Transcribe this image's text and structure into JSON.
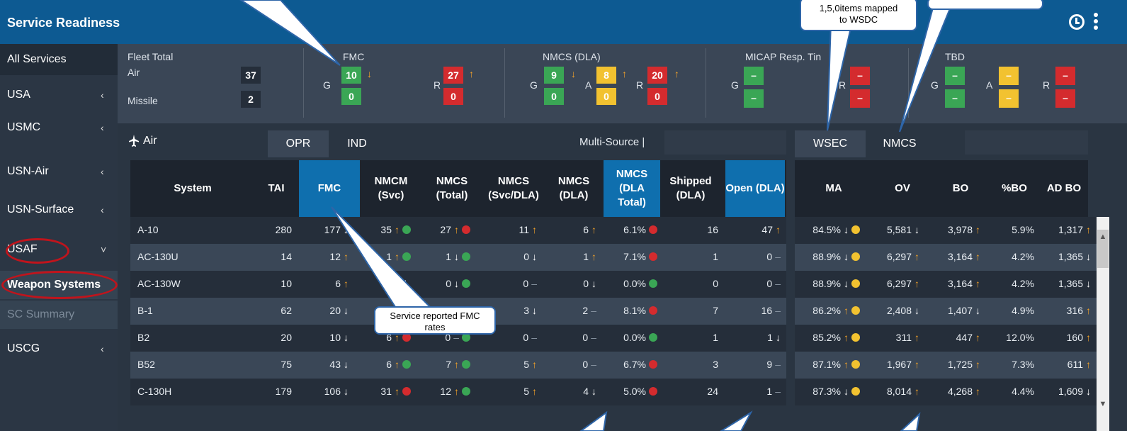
{
  "titlebar": {
    "title": "Service Readiness"
  },
  "sidebar": {
    "items": [
      {
        "label": "All Services"
      },
      {
        "label": "USA",
        "chevron": "‹"
      },
      {
        "label": "USMC",
        "chevron": "‹"
      },
      {
        "label": "USN-Air",
        "chevron": "‹"
      },
      {
        "label": "USN-Surface",
        "chevron": "‹"
      },
      {
        "label": "USAF",
        "chevron": "˅"
      },
      {
        "label": "Weapon Systems"
      },
      {
        "label": "SC Summary"
      },
      {
        "label": "USCG",
        "chevron": "‹"
      }
    ]
  },
  "summary": {
    "fleet": {
      "title": "Fleet Total",
      "air_label": "Air",
      "air_value": "37",
      "missile_label": "Missile",
      "missile_value": "2"
    },
    "fmc": {
      "title": "FMC",
      "g": "G",
      "r": "R",
      "g_top": "10",
      "g_top_arrow": "↓",
      "g_bottom": "0",
      "r_top": "27",
      "r_top_arrow": "↑",
      "r_bottom": "0"
    },
    "nmcs": {
      "title": "NMCS (DLA)",
      "g": "G",
      "a": "A",
      "r": "R",
      "g_top": "9",
      "g_top_arrow": "↓",
      "g_bottom": "0",
      "a_top": "8",
      "a_top_arrow": "↑",
      "a_bottom": "0",
      "r_top": "20",
      "r_top_arrow": "↑",
      "r_bottom": "0"
    },
    "micap": {
      "title": "MICAP Resp. Tin",
      "g": "G",
      "r": "R",
      "dash": "–"
    },
    "tbd": {
      "title": "TBD",
      "g": "G",
      "a": "A",
      "r": "R",
      "dash": "–"
    }
  },
  "toolbar": {
    "air_icon": "airplane-icon",
    "air_label": "Air",
    "tab_opr": "OPR",
    "tab_ind": "IND",
    "multisource": "Multi-Source |",
    "tab_wsec": "WSEC",
    "tab_nmcs": "NMCS"
  },
  "left_table": {
    "headers": [
      "System",
      "TAI",
      "FMC",
      "NMCM (Svc)",
      "NMCS (Total)",
      "NMCS (Svc/DLA)",
      "NMCS (DLA)",
      "NMCS (DLA Total)",
      "Shipped (DLA)",
      "Open (DLA)"
    ],
    "rows": [
      {
        "system": "A-10",
        "tai": "280",
        "fmc": "177",
        "fmc_a": "↓",
        "nmcm": "35",
        "nmcm_a": "↑",
        "nmcm_s": "ok",
        "nmcs_t": "27",
        "nmcs_t_a": "↑",
        "nmcs_t_s": "bad",
        "svcdla": "11",
        "svcdla_a": "↑",
        "dla": "6",
        "dla_a": "↑",
        "dlatot": "6.1%",
        "dlatot_s": "bad",
        "shipped": "16",
        "open": "47",
        "open_a": "↑"
      },
      {
        "system": "AC-130U",
        "tai": "14",
        "fmc": "12",
        "fmc_a": "↑",
        "nmcm": "1",
        "nmcm_a": "↑",
        "nmcm_s": "ok",
        "nmcs_t": "1",
        "nmcs_t_a": "↓",
        "nmcs_t_s": "ok",
        "svcdla": "0",
        "svcdla_a": "↓",
        "dla": "1",
        "dla_a": "↑",
        "dlatot": "7.1%",
        "dlatot_s": "bad",
        "shipped": "1",
        "open": "0",
        "open_a": "–"
      },
      {
        "system": "AC-130W",
        "tai": "10",
        "fmc": "6",
        "fmc_a": "↑",
        "nmcm": "1",
        "nmcm_a": "",
        "nmcm_s": "",
        "nmcs_t": "0",
        "nmcs_t_a": "↓",
        "nmcs_t_s": "ok",
        "svcdla": "0",
        "svcdla_a": "–",
        "dla": "0",
        "dla_a": "↓",
        "dlatot": "0.0%",
        "dlatot_s": "ok",
        "shipped": "0",
        "open": "0",
        "open_a": "–"
      },
      {
        "system": "B-1",
        "tai": "62",
        "fmc": "20",
        "fmc_a": "↓",
        "nmcm": "",
        "nmcm_a": "",
        "nmcm_s": "",
        "nmcs_t": "",
        "nmcs_t_a": "",
        "nmcs_t_s": "",
        "svcdla": "3",
        "svcdla_a": "↓",
        "dla": "2",
        "dla_a": "–",
        "dlatot": "8.1%",
        "dlatot_s": "bad",
        "shipped": "7",
        "open": "16",
        "open_a": "–"
      },
      {
        "system": "B2",
        "tai": "20",
        "fmc": "10",
        "fmc_a": "↓",
        "nmcm": "6",
        "nmcm_a": "↑",
        "nmcm_s": "bad",
        "nmcs_t": "0",
        "nmcs_t_a": "–",
        "nmcs_t_s": "ok",
        "svcdla": "0",
        "svcdla_a": "–",
        "dla": "0",
        "dla_a": "–",
        "dlatot": "0.0%",
        "dlatot_s": "ok",
        "shipped": "1",
        "open": "1",
        "open_a": "↓"
      },
      {
        "system": "B52",
        "tai": "75",
        "fmc": "43",
        "fmc_a": "↓",
        "nmcm": "6",
        "nmcm_a": "↑",
        "nmcm_s": "ok",
        "nmcs_t": "7",
        "nmcs_t_a": "↑",
        "nmcs_t_s": "ok",
        "svcdla": "5",
        "svcdla_a": "↑",
        "dla": "0",
        "dla_a": "–",
        "dlatot": "6.7%",
        "dlatot_s": "bad",
        "shipped": "3",
        "open": "9",
        "open_a": "–"
      },
      {
        "system": "C-130H",
        "tai": "179",
        "fmc": "106",
        "fmc_a": "↓",
        "nmcm": "31",
        "nmcm_a": "↑",
        "nmcm_s": "bad",
        "nmcs_t": "12",
        "nmcs_t_a": "↑",
        "nmcs_t_s": "ok",
        "svcdla": "5",
        "svcdla_a": "↑",
        "dla": "4",
        "dla_a": "↓",
        "dlatot": "5.0%",
        "dlatot_s": "bad",
        "shipped": "24",
        "open": "1",
        "open_a": "–"
      }
    ]
  },
  "right_table": {
    "headers": [
      "MA",
      "OV",
      "BO",
      "%BO",
      "AD BO"
    ],
    "rows": [
      {
        "ma": "84.5%",
        "ma_a": "↓",
        "ov": "5,581",
        "ov_a": "↓",
        "bo": "3,978",
        "bo_a": "↑",
        "pbo": "5.9%",
        "adbo": "1,317",
        "adbo_a": "↑"
      },
      {
        "ma": "88.9%",
        "ma_a": "↓",
        "ov": "6,297",
        "ov_a": "↑",
        "bo": "3,164",
        "bo_a": "↑",
        "pbo": "4.2%",
        "adbo": "1,365",
        "adbo_a": "↓"
      },
      {
        "ma": "88.9%",
        "ma_a": "↓",
        "ov": "6,297",
        "ov_a": "↑",
        "bo": "3,164",
        "bo_a": "↑",
        "pbo": "4.2%",
        "adbo": "1,365",
        "adbo_a": "↓"
      },
      {
        "ma": "86.2%",
        "ma_a": "↑",
        "ov": "2,408",
        "ov_a": "↓",
        "bo": "1,407",
        "bo_a": "↓",
        "pbo": "4.9%",
        "adbo": "316",
        "adbo_a": "↑"
      },
      {
        "ma": "85.2%",
        "ma_a": "↑",
        "ov": "311",
        "ov_a": "↑",
        "bo": "447",
        "bo_a": "↑",
        "pbo": "12.0%",
        "adbo": "160",
        "adbo_a": "↑"
      },
      {
        "ma": "87.1%",
        "ma_a": "↑",
        "ov": "1,967",
        "ov_a": "↑",
        "bo": "1,725",
        "bo_a": "↑",
        "pbo": "7.3%",
        "adbo": "611",
        "adbo_a": "↑"
      },
      {
        "ma": "87.3%",
        "ma_a": "↓",
        "ov": "8,014",
        "ov_a": "↑",
        "bo": "4,268",
        "bo_a": "↑",
        "pbo": "4.4%",
        "adbo": "1,609",
        "adbo_a": "↓"
      }
    ]
  },
  "callouts": {
    "fmc_rates": "Service reported FMC rates",
    "wsdc_line1": "1,5,0items mapped",
    "wsdc_line2": "to WSDC"
  },
  "colors": {
    "titlebar": "#0d5a92",
    "highlight_header": "#0f6fae",
    "green": "#3aa655",
    "red": "#d42b2e",
    "amber": "#f2c230",
    "arrow_up": "#f2a22a",
    "annotation_ring": "#c0141c"
  }
}
